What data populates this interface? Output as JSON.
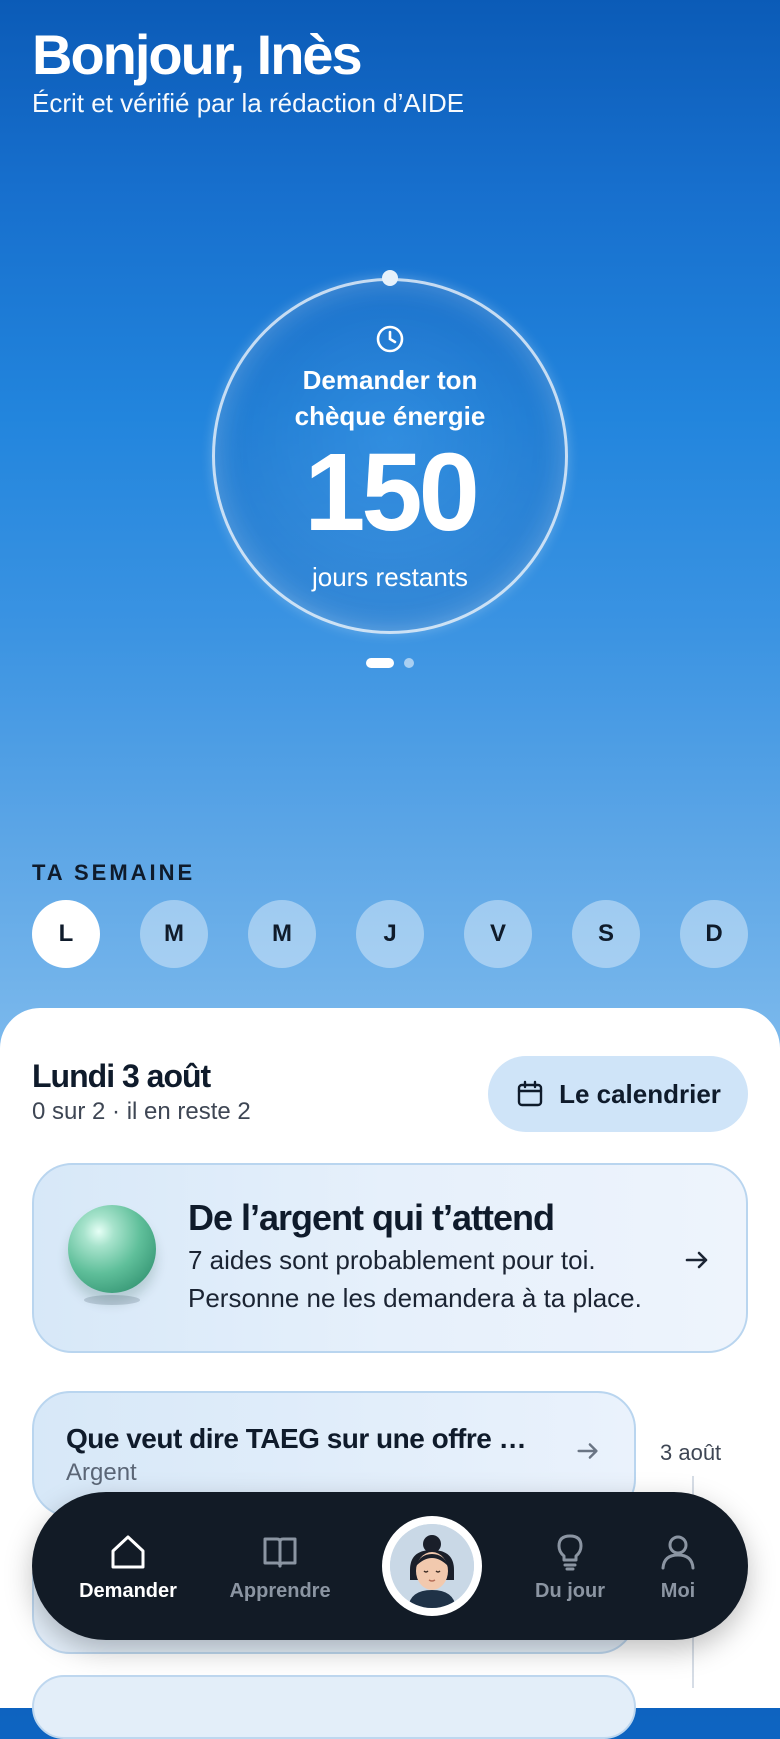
{
  "header": {
    "greeting": "Bonjour, Inès",
    "subtitle": "Écrit et vérifié par la rédaction d’AIDE"
  },
  "countdown": {
    "icon": "clock-icon",
    "label_line1": "Demander ton",
    "label_line2": "chèque énergie",
    "value": "150",
    "unit": "jours restants",
    "pager": {
      "pages": 2,
      "active_index": 0
    }
  },
  "week": {
    "title": "TA SEMAINE",
    "days": [
      "L",
      "M",
      "M",
      "J",
      "V",
      "S",
      "D"
    ],
    "selected_index": 0
  },
  "today": {
    "title": "Lundi 3 août",
    "progress": "0 sur 2 · il en reste 2",
    "calendar_button": "Le calendrier"
  },
  "money_card": {
    "title": "De l’argent qui t’attend",
    "line1": "7 aides sont probablement pour toi.",
    "line2": "Personne ne les demandera à ta place."
  },
  "feed": [
    {
      "title": "Que veut dire TAEG sur une offre …",
      "category": "Argent",
      "date": "3 août"
    }
  ],
  "nav": {
    "items": [
      "Demander",
      "Apprendre",
      "Du jour",
      "Moi"
    ],
    "active": "Demander",
    "colors": {
      "active": "#ffffff",
      "inactive": "#8b95a2",
      "bar": "#121b26"
    }
  },
  "theme": {
    "accent": "#1677d2",
    "card_bg": "#d7e8f8"
  }
}
